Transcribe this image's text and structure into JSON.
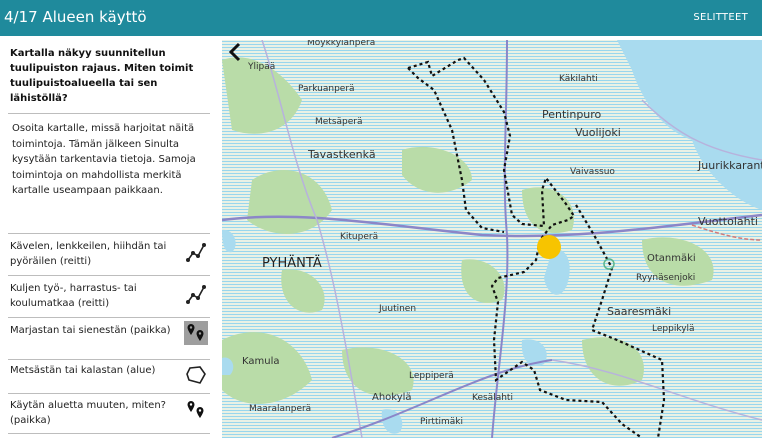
{
  "header": {
    "title": "4/17 Alueen käyttö",
    "legend_label": "SELITTEET"
  },
  "question": "Kartalla näkyy suunnitellun tuulipuiston rajaus. Miten toimit tuulipuistoalueella tai sen lähistöllä?",
  "instruction": "Osoita kartalle, missä harjoitat näitä toimintoja. Tämän jälkeen Sinulta kysytään tarkentavia tietoja. Samoja toimintoja on mahdollista merkitä kartalle useampaan paikkaan.",
  "actions": [
    {
      "label": "Kävelen, lenkkeilen, hiihdän tai pyöräilen (reitti)",
      "icon": "route-icon"
    },
    {
      "label": "Kuljen työ-, harrastus- tai koulumatkaa (reitti)",
      "icon": "route-icon"
    },
    {
      "label": "Marjastan tai sienestän (paikka)",
      "icon": "location-pins-icon",
      "active": true
    },
    {
      "label": "Metsästän tai kalastan (alue)",
      "icon": "area-polygon-icon"
    },
    {
      "label": "Käytän aluetta muuten, miten? (paikka)",
      "icon": "location-pins-icon"
    }
  ],
  "map": {
    "places": [
      "Moykkylänperä",
      "Ylipää",
      "Parkuanperä",
      "Käkilahti",
      "Pentinpuro",
      "Metsäperä",
      "Vuolijoki",
      "Tavastkenkä",
      "Vaivassuo",
      "Juurikkaranta",
      "Vuottolahti",
      "Kituperä",
      "PYHÄNTÄ",
      "Otanmäki",
      "Ryynäsenjoki",
      "Saaresmäki",
      "Juutinen",
      "Leppikylä",
      "Kamula",
      "Leppiperä",
      "Ahokylä",
      "Maaralanperä",
      "Kesälahti",
      "Pirttimäki"
    ],
    "colors": {
      "land": "#e6eee0",
      "water": "#a9dbef",
      "forest": "#b9dca8",
      "boundary": "#111111",
      "marker": "#f7c400",
      "road": "#8b86c8"
    }
  }
}
